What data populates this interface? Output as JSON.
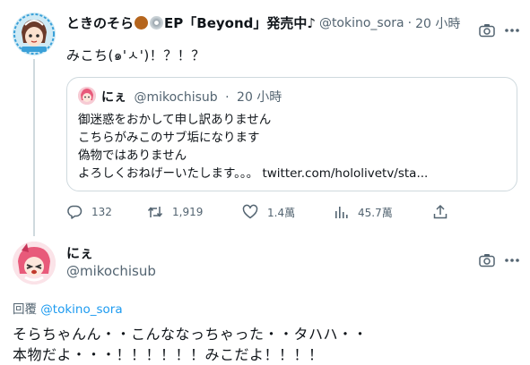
{
  "tweet1": {
    "display_name_prefix": "ときのそら",
    "display_name_suffix": "EP「Beyond」発売中♪",
    "handle": "@tokino_sora",
    "separator": "·",
    "time": "20 小時",
    "text": "みこち(๑'ㅅ')！？！？",
    "avatar_icon": "user-avatar-sora",
    "badge_icons": [
      "bear-emoji-icon",
      "cd-emoji-icon"
    ]
  },
  "quote": {
    "display_name": "にぇ",
    "handle": "@mikochisub",
    "separator": "·",
    "time": "20 小時",
    "lines": [
      "御迷惑をおかして申し訳ありません",
      "こちらがみこのサブ垢になります",
      "偽物ではありません",
      "よろしくおねげーいたします。。。 twitter.com/hololivetv/sta..."
    ]
  },
  "actions": {
    "reply_count": "132",
    "retweet_count": "1,919",
    "like_count": "1.4萬",
    "view_count": "45.7萬"
  },
  "tweet2": {
    "display_name": "にぇ",
    "handle": "@mikochisub",
    "reply_prefix": "回覆",
    "reply_to": "@tokino_sora",
    "lines": [
      "そらちゃんん・・こんななっちゃった・・タハハ・・",
      "本物だよ・・・！！！！！！みこだよ！！！！"
    ]
  },
  "colors": {
    "text": "#0f1419",
    "secondary": "#536471",
    "link": "#1d9bf0",
    "border": "#cfd9de"
  }
}
